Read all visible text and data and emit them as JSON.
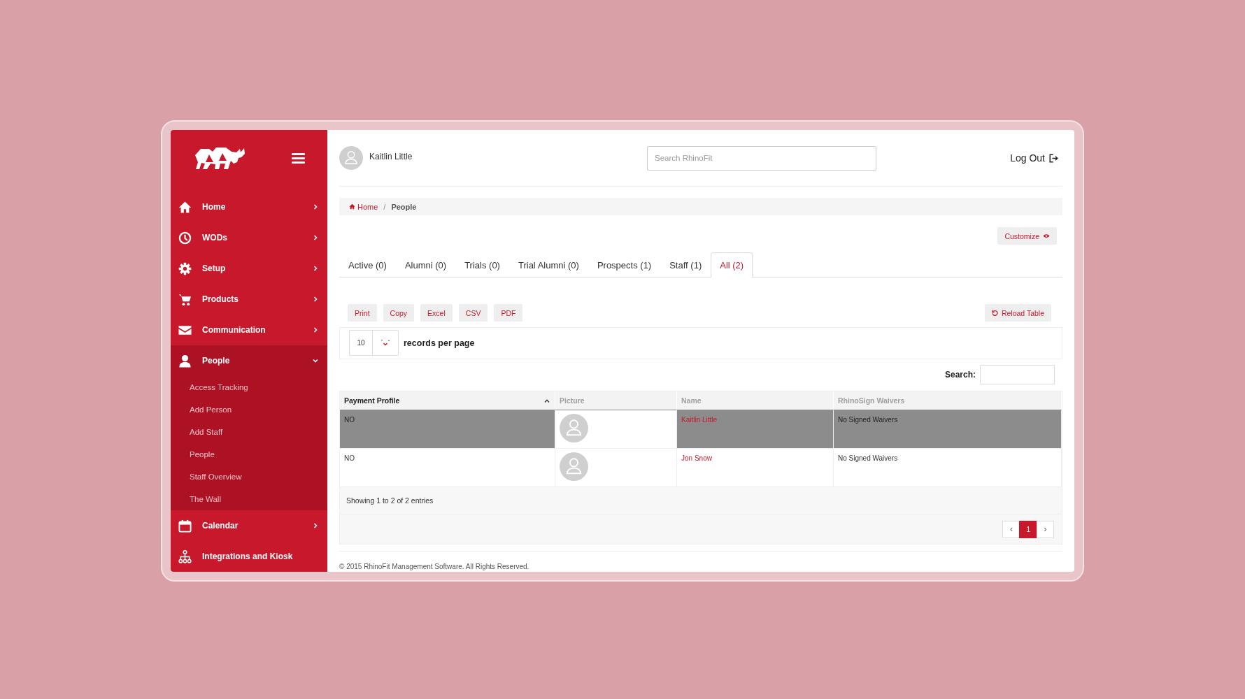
{
  "sidebar": {
    "items": [
      {
        "label": "Home",
        "kind": "submenu",
        "expanded": false
      },
      {
        "label": "WODs",
        "kind": "submenu",
        "expanded": false
      },
      {
        "label": "Setup",
        "kind": "submenu",
        "expanded": false
      },
      {
        "label": "Products",
        "kind": "submenu",
        "expanded": false
      },
      {
        "label": "Communication",
        "kind": "submenu",
        "expanded": false
      },
      {
        "label": "People",
        "kind": "submenu",
        "expanded": true,
        "children": [
          {
            "label": "Access Tracking"
          },
          {
            "label": "Add Person"
          },
          {
            "label": "Add Staff"
          },
          {
            "label": "People"
          },
          {
            "label": "Staff Overview"
          },
          {
            "label": "The Wall"
          }
        ]
      },
      {
        "label": "Calendar",
        "kind": "submenu",
        "expanded": false
      },
      {
        "label": "Integrations and Kiosk",
        "kind": "link"
      }
    ]
  },
  "header": {
    "user_name": "Kaitlin Little",
    "search": {
      "placeholder": "Search RhinoFit"
    },
    "logout": "Log Out"
  },
  "breadcrumb": {
    "items": [
      {
        "label": "Home",
        "kind": "link"
      },
      {
        "label": "People",
        "kind": "current"
      }
    ],
    "separator": "/"
  },
  "customize": "Customize",
  "tabs": [
    {
      "label": "Active (0)",
      "selected": false
    },
    {
      "label": "Alumni (0)",
      "selected": false
    },
    {
      "label": "Trials (0)",
      "selected": false
    },
    {
      "label": "Trial Alumni (0)",
      "selected": false
    },
    {
      "label": "Prospects (1)",
      "selected": false
    },
    {
      "label": "Staff (1)",
      "selected": false
    },
    {
      "label": "All (2)",
      "selected": true
    }
  ],
  "export_buttons": [
    "Print",
    "Copy",
    "Excel",
    "CSV",
    "PDF"
  ],
  "reload": "Reload Table",
  "page_length": {
    "value": "10",
    "label": "records per page"
  },
  "table_search": {
    "label": "Search:"
  },
  "table": {
    "columns": [
      {
        "label": "Payment Profile",
        "sorted": true
      },
      {
        "label": "Picture",
        "sorted": false
      },
      {
        "label": "Name",
        "sorted": false
      },
      {
        "label": "RhinoSign Waivers",
        "sorted": false
      }
    ],
    "rows": [
      {
        "payment_profile": "NO",
        "name": "Kaitlin Little",
        "waivers": "No Signed Waivers",
        "selected": true
      },
      {
        "payment_profile": "NO",
        "name": "Jon Snow",
        "waivers": "No Signed Waivers",
        "selected": false
      }
    ]
  },
  "info": "Showing 1 to 2 of 2 entries",
  "pagination": {
    "previous": "‹",
    "pages": [
      {
        "label": "1",
        "selected": true
      }
    ],
    "next": "›"
  },
  "footer": "© 2015 RhinoFit Management Software. All Rights Reserved."
}
